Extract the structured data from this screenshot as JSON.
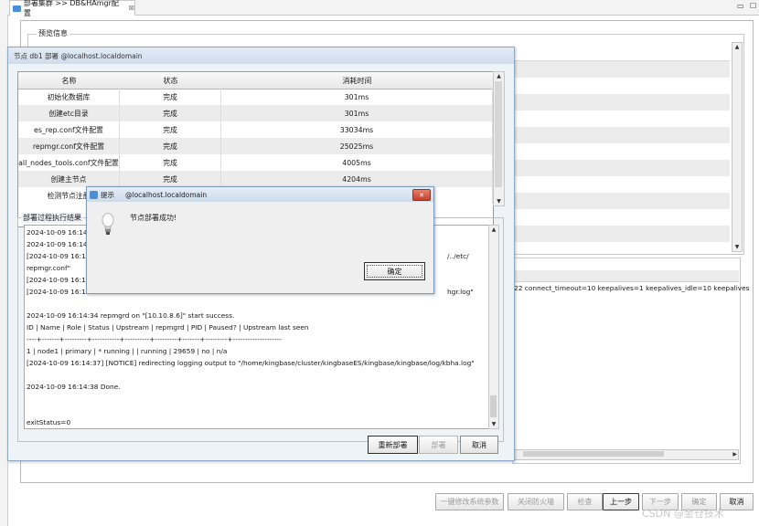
{
  "editor_tab": {
    "title": "部署集群 >> DB&HAmgr配置",
    "close_glyph": "☒"
  },
  "window_controls": {
    "minimize": "▭",
    "maximize": "☐"
  },
  "preview": {
    "label": "预览信息",
    "background_log_text": "22 connect_timeout=10 keepalives=1 keepalives_idle=10 keepalives"
  },
  "bottom_buttons": [
    {
      "label": "一键修改系统参数",
      "enabled": false
    },
    {
      "label": "关闭防火墙",
      "enabled": false
    },
    {
      "label": "检查",
      "enabled": false
    },
    {
      "label": "上一步",
      "enabled": true
    },
    {
      "label": "下一步",
      "enabled": false
    },
    {
      "label": "确定",
      "enabled": false
    },
    {
      "label": "取消",
      "enabled": true
    }
  ],
  "dialog": {
    "title": "节点 db1 部署 @localhost.localdomain",
    "table": {
      "headers": [
        "名称",
        "状态",
        "消耗时间"
      ],
      "rows": [
        [
          "初始化数据库",
          "完成",
          "301ms"
        ],
        [
          "创建etc目录",
          "完成",
          "301ms"
        ],
        [
          "es_rep.conf文件配置",
          "完成",
          "33034ms"
        ],
        [
          "repmgr.conf文件配置",
          "完成",
          "25025ms"
        ],
        [
          "all_nodes_tools.conf文件配置",
          "完成",
          "4005ms"
        ],
        [
          "创建主节点",
          "完成",
          "4204ms"
        ],
        [
          "检测节点注册",
          "",
          ""
        ]
      ]
    },
    "log_label": "部署过程执行结果",
    "log_lines": [
      "2024-10-09 16:14:3",
      "2024-10-09 16:14:3",
      "[2024-10-09 16:14:3",
      "repmgr.conf\"",
      "[2024-10-09 16:14:3",
      "[2024-10-09 16:14:3",
      "",
      "2024-10-09 16:14:34 repmgrd on \"[10.10.8.6]\" start success.",
      " ID | Name  | Role    | Status    | Upstream | repmgrd | PID   | Paused? | Upstream last seen",
      "----+-------+---------+-----------+----------+---------+-------+---------+--------------------",
      " 1  | node1 | primary | * running |          | running | 29659 | no      | n/a",
      "[2024-10-09 16:14:37] [NOTICE] redirecting logging output to \"/home/kingbase/cluster/kingbaseES/kingbase/kingbase/log/kbha.log\"",
      "",
      "2024-10-09 16:14:38 Done.",
      "",
      "",
      "",
      "exitStatus=0"
    ],
    "log_tail_fragments": {
      "etc": "/../etc/",
      "hgr_log": "hgr.log\""
    },
    "buttons": {
      "redeploy": "重新部署",
      "deploy": "部署",
      "cancel": "取消"
    }
  },
  "alert": {
    "title_app": "提示",
    "title_host": "@localhost.localdomain",
    "message": "节点部署成功!",
    "ok_label": "确定",
    "close_glyph": "✕"
  },
  "watermark": "CSDN @金仓技术"
}
